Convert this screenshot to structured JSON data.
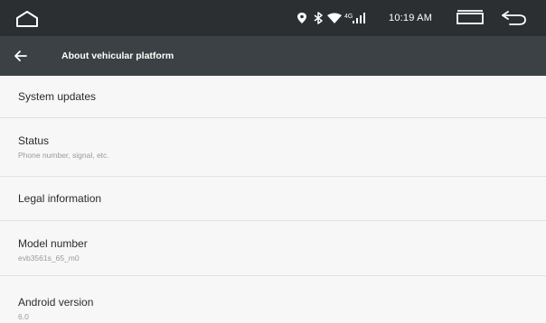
{
  "status_bar": {
    "time": "10:19 AM",
    "icons": [
      "location-icon",
      "bluetooth-icon",
      "wifi-icon",
      "cell-signal-icon"
    ],
    "nav_icons": [
      "home-icon",
      "recents-icon",
      "back-icon"
    ]
  },
  "action_bar": {
    "title": "About vehicular platform",
    "up_icon": "arrow-left-icon"
  },
  "items": [
    {
      "title": "System updates"
    },
    {
      "title": "Status",
      "summary": "Phone number, signal, etc."
    },
    {
      "title": "Legal information"
    },
    {
      "title": "Model number",
      "summary": "evb3561s_65_m0"
    },
    {
      "title": "Android version",
      "summary": "6.0"
    }
  ],
  "colors": {
    "status_bar": "#2b2f31",
    "action_bar": "#3b4144",
    "list_background": "#f7f7f7",
    "title_text": "#2b2b2b",
    "summary_text": "#9a9a9a"
  }
}
